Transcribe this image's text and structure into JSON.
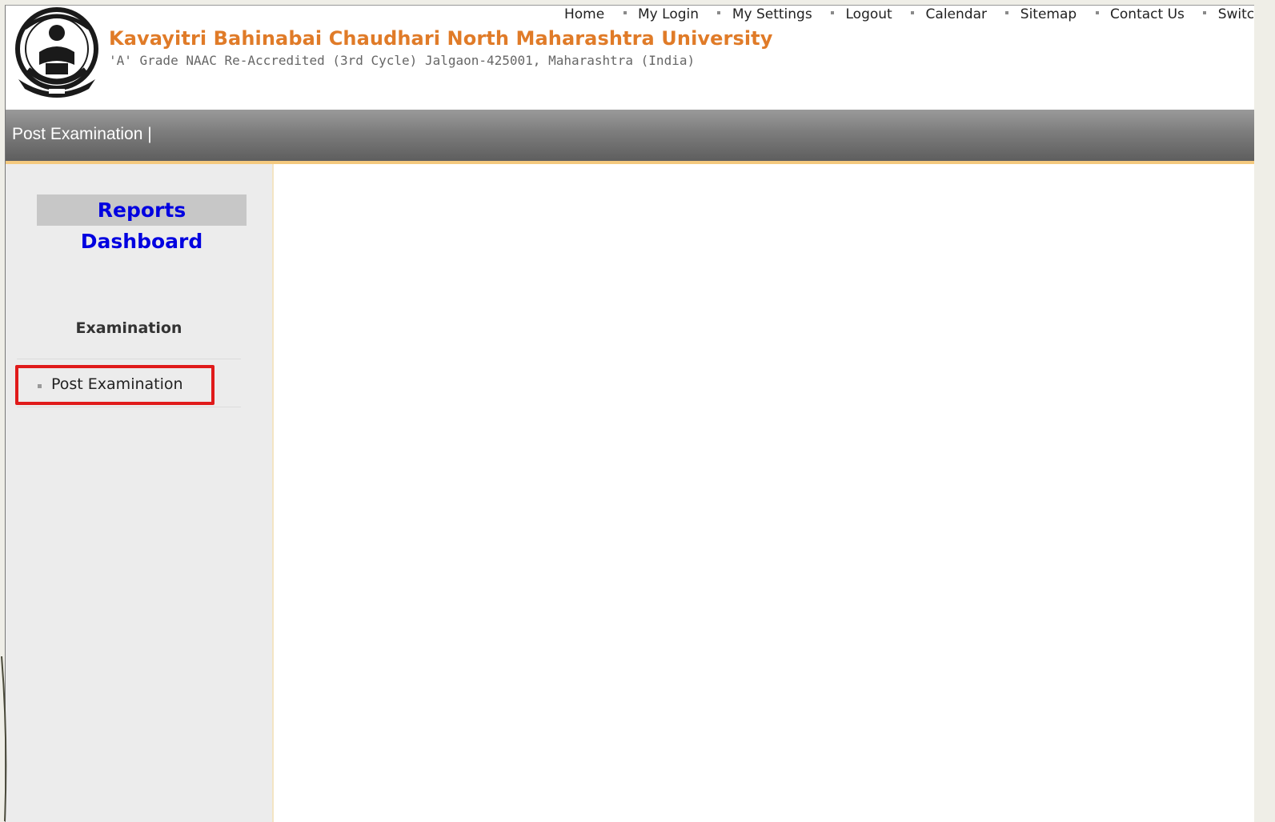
{
  "top_links": [
    "Home",
    "My Login",
    "My Settings",
    "Logout",
    "Calendar",
    "Sitemap",
    "Contact Us",
    "Switch T"
  ],
  "university": {
    "name": "Kavayitri Bahinabai Chaudhari North Maharashtra University",
    "subtitle": "'A' Grade NAAC Re-Accredited (3rd Cycle) Jalgaon-425001, Maharashtra (India)",
    "logo_icon": "university-seal-icon"
  },
  "menubar": {
    "label": "Post Examination |"
  },
  "sidebar": {
    "dashboard_label": "Reports Dashboard",
    "section_heading": "Examination",
    "items": [
      {
        "label": "Post Examination",
        "highlighted": true
      }
    ]
  },
  "colors": {
    "university_name": "#e07b28",
    "dashboard_link": "#0000e0",
    "highlight_border": "#e01b1b",
    "menubar_accent": "#f4c97e"
  }
}
